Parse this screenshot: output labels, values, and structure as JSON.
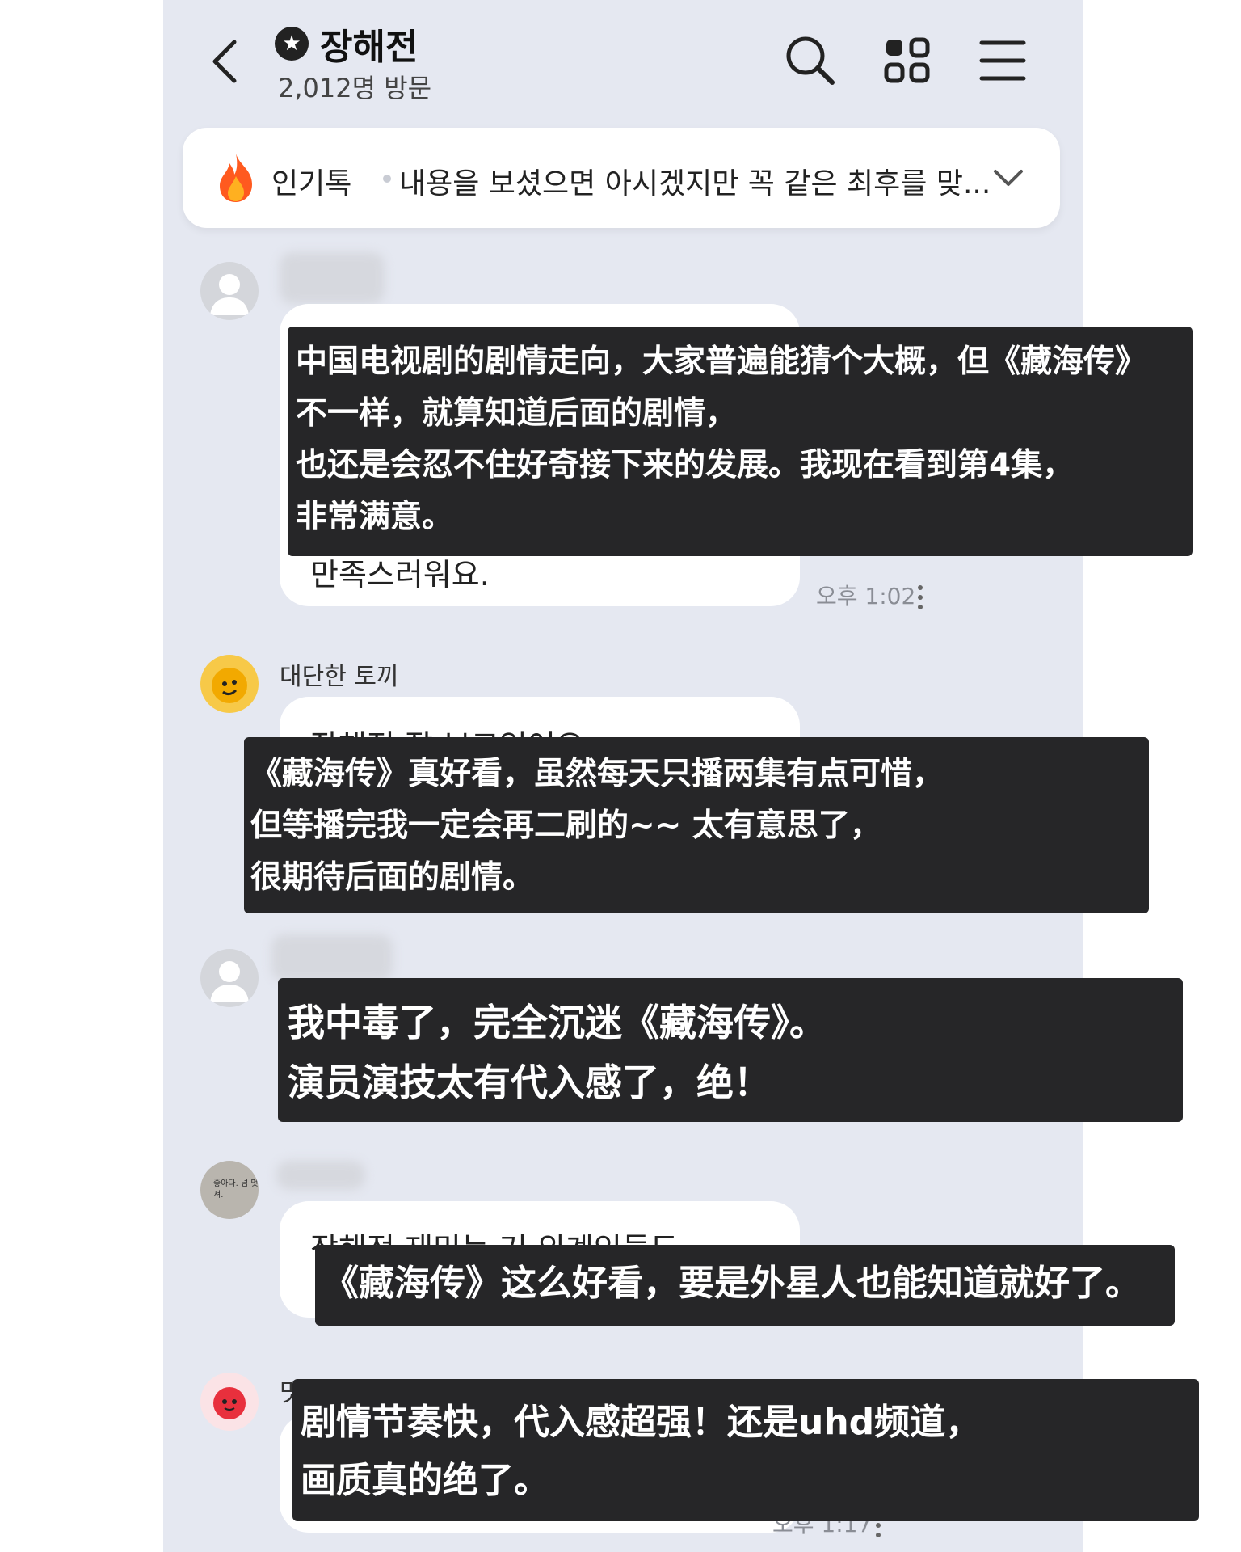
{
  "header": {
    "back_icon": "chevron-left-icon",
    "badge_icon": "star-badge-icon",
    "title": "장해전",
    "visitors": "2,012명 방문",
    "search_icon": "search-icon",
    "apps_icon": "grid-icon",
    "menu_icon": "hamburger-menu-icon"
  },
  "popular": {
    "icon": "fire-icon",
    "label": "인기톡",
    "text": "내용을 보셨으면 아시겠지만 꼭 같은 최후를 맞...",
    "chevron_icon": "chevron-down-icon"
  },
  "messages": [
    {
      "name": "",
      "partial_text": "만족스러워요.",
      "time": "오후 1:02"
    },
    {
      "name": "대단한 토끼",
      "partial_text": "장해전 잘 보고있어요"
    },
    {
      "name": "",
      "partial_text": ""
    },
    {
      "name": "",
      "partial_text": "장해전 재미는 거 외계인들도",
      "avatar_caption": "좋아다. 넘 멋져."
    },
    {
      "name": "멋진 패키",
      "time": "오후 1:17"
    }
  ],
  "overlays": [
    {
      "lines": [
        "中国电视剧的剧情走向，大家普遍能猜个大概，但《藏海传》",
        "不一样，就算知道后面的剧情，",
        "也还是会忍不住好奇接下来的发展。我现在看到第4集，",
        "非常满意。"
      ]
    },
    {
      "lines": [
        "《藏海传》真好看，虽然每天只播两集有点可惜，",
        "但等播完我一定会再二刷的~~ 太有意思了，",
        "很期待后面的剧情。"
      ]
    },
    {
      "lines": [
        "我中毒了，完全沉迷《藏海传》。",
        "演员演技太有代入感了，绝！"
      ]
    },
    {
      "lines": [
        "《藏海传》这么好看，要是外星人也能知道就好了。"
      ]
    },
    {
      "lines": [
        "剧情节奏快，代入感超强！还是uhd频道，",
        "画质真的绝了。"
      ]
    }
  ],
  "colors": {
    "chat_background": "#e5e8f1",
    "overlay_background": "#262628",
    "bubble": "#ffffff"
  }
}
